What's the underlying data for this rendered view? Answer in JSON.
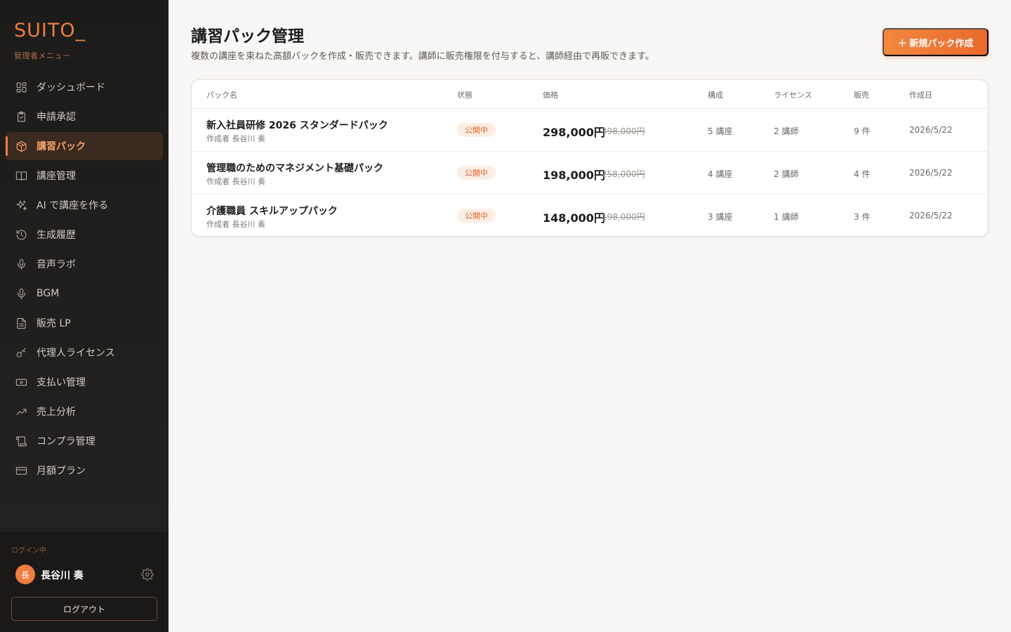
{
  "sidebar": {
    "brand": "SUITO_",
    "subtitle": "管理者メニュー",
    "items": [
      {
        "label": "ダッシュボード",
        "icon": "dashboard-icon"
      },
      {
        "label": "申請承認",
        "icon": "clipboard-check-icon"
      },
      {
        "label": "講習パック",
        "icon": "package-icon",
        "active": true
      },
      {
        "label": "講座管理",
        "icon": "book-open-icon"
      },
      {
        "label": "AI で講座を作る",
        "icon": "sparkles-icon"
      },
      {
        "label": "生成履歴",
        "icon": "history-icon"
      },
      {
        "label": "音声ラボ",
        "icon": "microphone-icon"
      },
      {
        "label": "BGM",
        "icon": "microphone-icon"
      },
      {
        "label": "販売 LP",
        "icon": "document-icon"
      },
      {
        "label": "代理人ライセンス",
        "icon": "key-icon"
      },
      {
        "label": "支払い管理",
        "icon": "banknote-icon"
      },
      {
        "label": "売上分析",
        "icon": "trending-up-icon"
      },
      {
        "label": "コンプラ管理",
        "icon": "scroll-icon"
      },
      {
        "label": "月額プラン",
        "icon": "credit-card-icon"
      }
    ],
    "footer": {
      "login_label": "ログイン中",
      "avatar_initial": "長",
      "user_name": "長谷川 奏",
      "logout_label": "ログアウト"
    }
  },
  "main": {
    "title": "講習パック管理",
    "description": "複数の講座を束ねた高額パックを作成・販売できます。講師に販売権限を付与すると、講師経由で再販できます。",
    "new_button": "＋ 新規パック作成",
    "columns": {
      "name": "パック名",
      "status": "状態",
      "price": "価格",
      "composition": "構成",
      "license": "ライセンス",
      "sales": "販売",
      "created": "作成日"
    },
    "rows": [
      {
        "name": "新入社員研修 2026 スタンダードパック",
        "author": "作成者 長谷川 奏",
        "status": "公開中",
        "price": "298,000円",
        "old_price": "398,000円",
        "composition": "5 講座",
        "license": "2 講師",
        "sales": "9 件",
        "created": "2026/5/22"
      },
      {
        "name": "管理職のためのマネジメント基礎パック",
        "author": "作成者 長谷川 奏",
        "status": "公開中",
        "price": "198,000円",
        "old_price": "258,000円",
        "composition": "4 講座",
        "license": "2 講師",
        "sales": "4 件",
        "created": "2026/5/22"
      },
      {
        "name": "介護職員 スキルアップパック",
        "author": "作成者 長谷川 奏",
        "status": "公開中",
        "price": "148,000円",
        "old_price": "198,000円",
        "composition": "3 講座",
        "license": "1 講師",
        "sales": "3 件",
        "created": "2026/5/22"
      }
    ]
  },
  "colors": {
    "accent": "#ee7d3f",
    "sidebar_bg": "#1c1b1a",
    "status_bg": "#fdeee4"
  }
}
